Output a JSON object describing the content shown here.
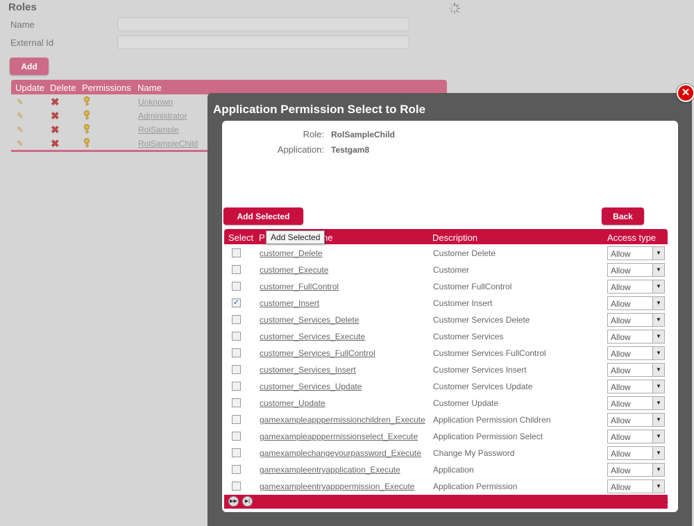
{
  "background": {
    "title": "Roles",
    "name_label": "Name",
    "external_id_label": "External Id",
    "name_value": "",
    "external_id_value": "",
    "add_label": "Add",
    "grid": {
      "columns": [
        "Update",
        "Delete",
        "Permissions",
        "Name"
      ],
      "rows": [
        {
          "name": "Unknown"
        },
        {
          "name": "Administrator"
        },
        {
          "name": "RolSample"
        },
        {
          "name": "RolSampleChild"
        }
      ]
    }
  },
  "modal": {
    "title": "Application Permission Select to Role",
    "close_symbol": "✕",
    "role_label": "Role:",
    "role_value": "RolSampleChild",
    "application_label": "Application:",
    "application_value": "Testgam8",
    "add_selected_label": "Add Selected",
    "back_label": "Back",
    "tooltip": "Add Selected",
    "grid": {
      "columns": {
        "select": "Select",
        "permission_prefix": "P",
        "permission_suffix": "ne",
        "description": "Description",
        "access_type": "Access type"
      },
      "rows": [
        {
          "name": "customer_Delete",
          "description": "Customer Delete",
          "access": "Allow",
          "checked": false
        },
        {
          "name": "customer_Execute",
          "description": "Customer",
          "access": "Allow",
          "checked": false
        },
        {
          "name": "customer_FullControl",
          "description": "Customer FullControl",
          "access": "Allow",
          "checked": false
        },
        {
          "name": "customer_Insert",
          "description": "Customer Insert",
          "access": "Allow",
          "checked": true
        },
        {
          "name": "customer_Services_Delete",
          "description": "Customer Services Delete",
          "access": "Allow",
          "checked": false
        },
        {
          "name": "customer_Services_Execute",
          "description": "Customer Services",
          "access": "Allow",
          "checked": false
        },
        {
          "name": "customer_Services_FullControl",
          "description": "Customer Services FullControl",
          "access": "Allow",
          "checked": false
        },
        {
          "name": "customer_Services_Insert",
          "description": "Customer Services Insert",
          "access": "Allow",
          "checked": false
        },
        {
          "name": "customer_Services_Update",
          "description": "Customer Services Update",
          "access": "Allow",
          "checked": false
        },
        {
          "name": "customer_Update",
          "description": "Customer Update",
          "access": "Allow",
          "checked": false
        },
        {
          "name": "gamexampleapppermissionchildren_Execute",
          "description": "Application Permission Children",
          "access": "Allow",
          "checked": false
        },
        {
          "name": "gamexampleapppermissionselect_Execute",
          "description": "Application Permission Select",
          "access": "Allow",
          "checked": false
        },
        {
          "name": "gamexamplechangeyourpassword_Execute",
          "description": "Change My Password",
          "access": "Allow",
          "checked": false
        },
        {
          "name": "gamexampleentryapplication_Execute",
          "description": "Application",
          "access": "Allow",
          "checked": false
        },
        {
          "name": "gamexampleentryapppermission_Execute",
          "description": "Application Permission",
          "access": "Allow",
          "checked": false
        }
      ]
    }
  }
}
